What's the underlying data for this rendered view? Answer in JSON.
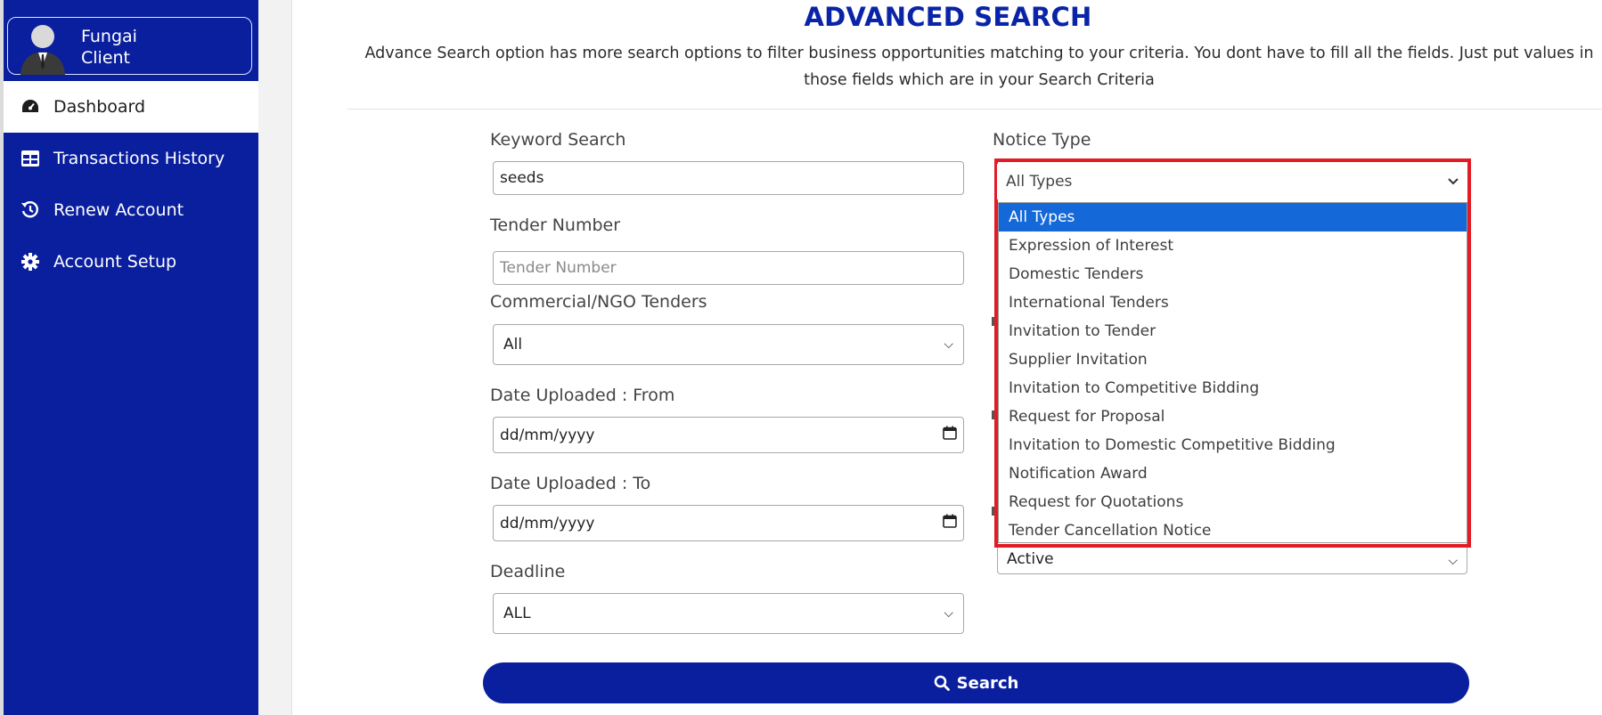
{
  "profile": {
    "name_line1": "Fungai",
    "name_line2": "Client"
  },
  "sidebar": {
    "items": [
      {
        "label": "Dashboard",
        "icon": "dashboard-gauge-icon",
        "active": true
      },
      {
        "label": "Transactions History",
        "icon": "table-icon",
        "active": false
      },
      {
        "label": "Renew Account",
        "icon": "history-icon",
        "active": false
      },
      {
        "label": "Account Setup",
        "icon": "gear-icon",
        "active": false
      }
    ]
  },
  "page": {
    "title": "ADVANCED SEARCH",
    "description": "Advance Search option has more search options to filter business opportunities matching to your criteria. You dont have to fill all the fields. Just put values in those fields which are in your Search Criteria"
  },
  "form": {
    "keyword": {
      "label": "Keyword Search",
      "value": "seeds"
    },
    "tender_number": {
      "label": "Tender Number",
      "placeholder": "Tender Number"
    },
    "commercial": {
      "label": "Commercial/NGO Tenders",
      "value": "All"
    },
    "date_from": {
      "label": "Date Uploaded : From",
      "value": "dd/mm/yyyy"
    },
    "date_to": {
      "label": "Date Uploaded : To",
      "value": "dd/mm/yyyy"
    },
    "deadline": {
      "label": "Deadline",
      "value": "ALL"
    },
    "notice_type": {
      "label": "Notice Type",
      "value": "All Types",
      "options": [
        "All Types",
        "Expression of Interest",
        "Domestic Tenders",
        "International Tenders",
        "Invitation to Tender",
        "Supplier Invitation",
        "Invitation to Competitive Bidding",
        "Request for Proposal",
        "Invitation to Domestic Competitive Bidding",
        "Notification Award",
        "Request for Quotations",
        "Tender Cancellation Notice"
      ],
      "selected_index": 0
    },
    "status": {
      "value": "Active"
    },
    "search_button": "Search"
  },
  "colors": {
    "sidebar": "#0a1f9e",
    "accent": "#0a24a8",
    "highlight": "#e21b24",
    "option_selected": "#1468d8"
  }
}
